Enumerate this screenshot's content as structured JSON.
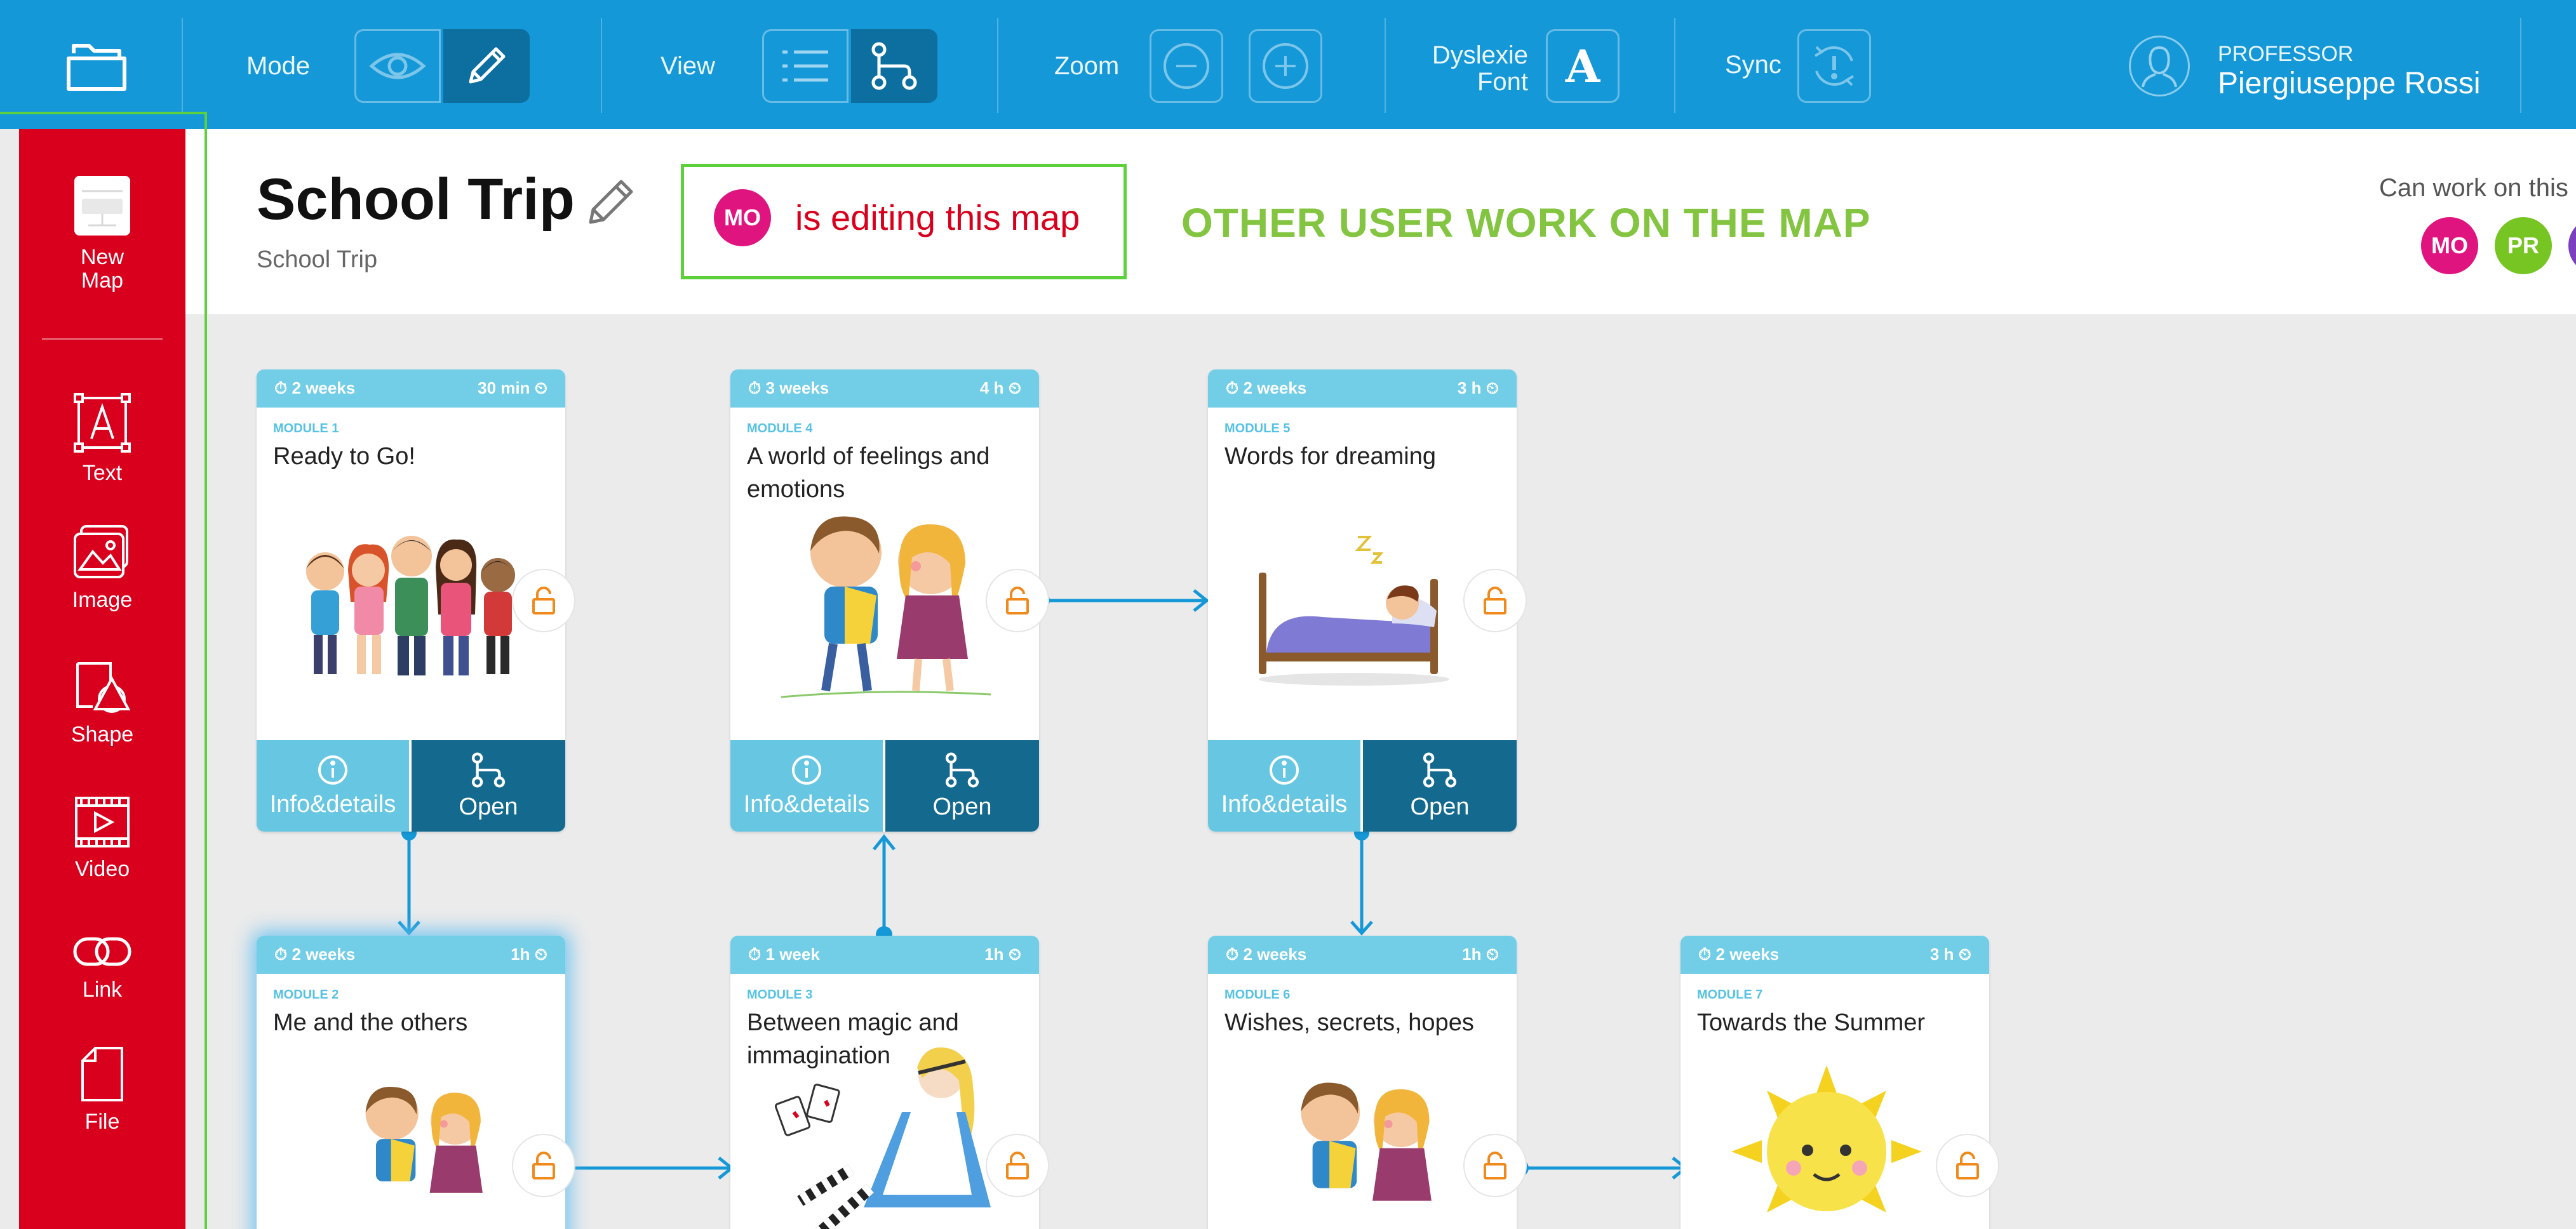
{
  "toolbar": {
    "mode_label": "Mode",
    "view_label": "View",
    "zoom_label": "Zoom",
    "dyslexie_label_1": "Dyslexie",
    "dyslexie_label_2": "Font",
    "dyslexie_letter": "A",
    "sync_label": "Sync",
    "user_role": "PROFESSOR",
    "user_name": "Piergiuseppe Rossi",
    "active_mode": "edit",
    "active_view": "map"
  },
  "sidebar": {
    "items": [
      {
        "label_1": "New",
        "label_2": "Map",
        "icon": "new-map-icon"
      },
      {
        "label": "Text",
        "icon": "text-icon"
      },
      {
        "label": "Image",
        "icon": "image-icon"
      },
      {
        "label": "Shape",
        "icon": "shape-icon"
      },
      {
        "label": "Video",
        "icon": "video-icon"
      },
      {
        "label": "Link",
        "icon": "link-icon"
      },
      {
        "label": "File",
        "icon": "file-icon"
      }
    ]
  },
  "header": {
    "title": "School Trip",
    "subtitle": "School Trip",
    "editing_avatar": "MO",
    "editing_text": "is editing this map",
    "annotation": "OTHER USER WORK ON THE MAP",
    "can_work_label": "Can work on this map",
    "collaborators": [
      {
        "initials": "MO",
        "color": "#e0147f"
      },
      {
        "initials": "PR",
        "color": "#77c523"
      },
      {
        "initials": "",
        "color": "#7b3fbf"
      }
    ]
  },
  "colors": {
    "topbar": "#1598d7",
    "sidebar": "#d8001d",
    "card_header": "#72cde6",
    "card_info": "#67c6e2",
    "card_open": "#14698f",
    "connector": "#1598d7",
    "lock": "#f08a1c",
    "annotation": "#83c540"
  },
  "cards": [
    {
      "duration": "2 weeks",
      "time": "30 min",
      "module": "MODULE 1",
      "title": "Ready to Go!",
      "info_label": "Info&details",
      "open_label": "Open"
    },
    {
      "duration": "3 weeks",
      "time": "4 h",
      "module": "MODULE 4",
      "title": "A world of feelings and emotions",
      "info_label": "Info&details",
      "open_label": "Open"
    },
    {
      "duration": "2 weeks",
      "time": "3 h",
      "module": "MODULE 5",
      "title": "Words for dreaming",
      "info_label": "Info&details",
      "open_label": "Open"
    },
    {
      "duration": "2 weeks",
      "time": "1h",
      "module": "MODULE 2",
      "title": "Me and the others"
    },
    {
      "duration": "1 week",
      "time": "1h",
      "module": "MODULE 3",
      "title": "Between magic and immagination"
    },
    {
      "duration": "2 weeks",
      "time": "1h",
      "module": "MODULE 6",
      "title": "Wishes, secrets, hopes"
    },
    {
      "duration": "2 weeks",
      "time": "3 h",
      "module": "MODULE 7",
      "title": "Towards the Summer"
    }
  ]
}
